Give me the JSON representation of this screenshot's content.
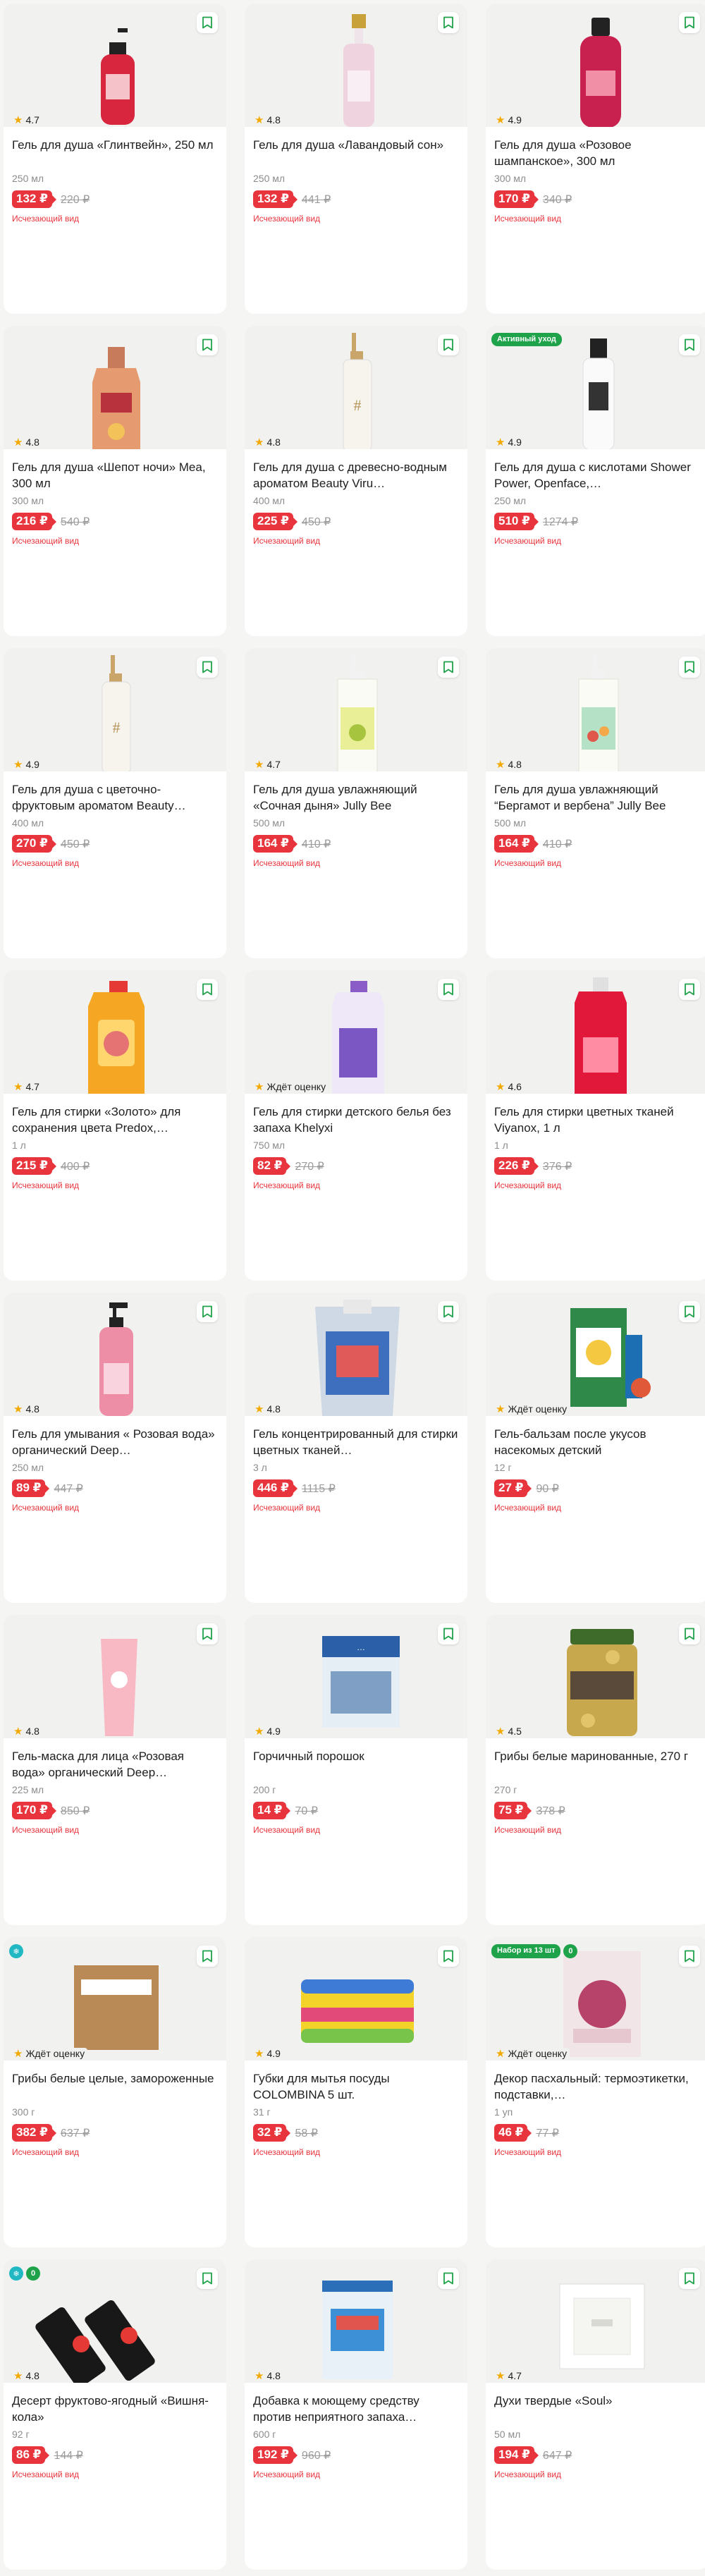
{
  "colors": {
    "sale": "#e8343c",
    "brand": "#1fa34a",
    "star": "#f2a900"
  },
  "products": [
    {
      "title": "Гель для душа «Глинтвейн», 250 мл",
      "rating": "4.7",
      "weight": "250 мл",
      "price": "132 ₽",
      "old_price": "220 ₽",
      "note": "Исчезающий вид",
      "art": "bottle-red"
    },
    {
      "title": "Гель для душа «Лавандовый сон»",
      "rating": "4.8",
      "weight": "250 мл",
      "price": "132 ₽",
      "old_price": "441 ₽",
      "note": "Исчезающий вид",
      "art": "bottle-pink-tall"
    },
    {
      "title": "Гель для душа «Розовое шампанское», 300 мл",
      "rating": "4.9",
      "weight": "300 мл",
      "price": "170 ₽",
      "old_price": "340 ₽",
      "note": "Исчезающий вид",
      "art": "bottle-magenta"
    },
    {
      "title": "Гель для душа «Шепот ночи» Mea, 300 мл",
      "rating": "4.8",
      "weight": "300 мл",
      "price": "216 ₽",
      "old_price": "540 ₽",
      "note": "Исчезающий вид",
      "art": "bottle-amber"
    },
    {
      "title": "Гель для душа с древесно-водным ароматом Beauty Viru…",
      "rating": "4.8",
      "weight": "400 мл",
      "price": "225 ₽",
      "old_price": "450 ₽",
      "note": "Исчезающий вид",
      "art": "bottle-white-pump"
    },
    {
      "title": "Гель для душа с кислотами Shower Power, Openface,…",
      "rating": "4.9",
      "weight": "250 мл",
      "price": "510 ₽",
      "old_price": "1274 ₽",
      "note": "Исчезающий вид",
      "art": "bottle-white-black",
      "badges": [
        "Активный уход"
      ]
    },
    {
      "title": "Гель для душа с цветочно-фруктовым ароматом Beauty…",
      "rating": "4.9",
      "weight": "400 мл",
      "price": "270 ₽",
      "old_price": "450 ₽",
      "note": "Исчезающий вид",
      "art": "bottle-white-pump"
    },
    {
      "title": "Гель для душа увлажняющий «Сочная дыня» Jully Bee",
      "rating": "4.7",
      "weight": "500 мл",
      "price": "164 ₽",
      "old_price": "410 ₽",
      "note": "Исчезающий вид",
      "art": "bottle-yellow-label"
    },
    {
      "title": "Гель для душа увлажняющий “Бергамот и вербена” Jully Bee",
      "rating": "4.8",
      "weight": "500 мл",
      "price": "164 ₽",
      "old_price": "410 ₽",
      "note": "Исчезающий вид",
      "art": "bottle-green-label"
    },
    {
      "title": "Гель для стирки «Золото» для сохранения цвета Predox,…",
      "rating": "4.7",
      "weight": "1 л",
      "price": "215 ₽",
      "old_price": "400 ₽",
      "note": "Исчезающий вид",
      "art": "detergent-yellow"
    },
    {
      "title": "Гель для стирки детского белья без запаха Khelyxi",
      "rating": "Ждёт оценку",
      "weight": "750 мл",
      "price": "82 ₽",
      "old_price": "270 ₽",
      "note": "Исчезающий вид",
      "art": "detergent-purple"
    },
    {
      "title": "Гель для стирки цветных тканей Viyanox, 1 л",
      "rating": "4.6",
      "weight": "1 л",
      "price": "226 ₽",
      "old_price": "376 ₽",
      "note": "Исчезающий вид",
      "art": "detergent-red"
    },
    {
      "title": "Гель для умывания « Розовая вода» органический Deep…",
      "rating": "4.8",
      "weight": "250 мл",
      "price": "89 ₽",
      "old_price": "447 ₽",
      "note": "Исчезающий вид",
      "art": "bottle-pink-pump"
    },
    {
      "title": "Гель концентрированный для стирки цветных тканей…",
      "rating": "4.8",
      "weight": "3 л",
      "price": "446 ₽",
      "old_price": "1115 ₽",
      "note": "Исчезающий вид",
      "art": "pouch-blue"
    },
    {
      "title": "Гель-бальзам после укусов насекомых детский",
      "rating": "Ждёт оценку",
      "weight": "12 г",
      "price": "27 ₽",
      "old_price": "90 ₽",
      "note": "Исчезающий вид",
      "art": "box-kids"
    },
    {
      "title": "Гель-маска для лица «Розовая вода» органический Deep…",
      "rating": "4.8",
      "weight": "225 мл",
      "price": "170 ₽",
      "old_price": "850 ₽",
      "note": "Исчезающий вид",
      "art": "tube-pink"
    },
    {
      "title": "Горчичный порошок",
      "rating": "4.9",
      "weight": "200 г",
      "price": "14 ₽",
      "old_price": "70 ₽",
      "note": "Исчезающий вид",
      "art": "box-mustard"
    },
    {
      "title": "Грибы белые маринованные, 270 г",
      "rating": "4.5",
      "weight": "270 г",
      "price": "75 ₽",
      "old_price": "378 ₽",
      "note": "Исчезающий вид",
      "art": "jar-mushrooms"
    },
    {
      "title": "Грибы белые целые, замороженные",
      "rating": "Ждёт оценку",
      "weight": "300 г",
      "price": "382 ₽",
      "old_price": "637 ₽",
      "note": "Исчезающий вид",
      "art": "box-kraft",
      "round_badges": [
        "❄"
      ]
    },
    {
      "title": "Губки для мытья посуды COLOMBINA 5 шт.",
      "rating": "4.9",
      "weight": "31 г",
      "price": "32 ₽",
      "old_price": "58 ₽",
      "note": "Исчезающий вид",
      "art": "sponges"
    },
    {
      "title": "Декор пасхальный: термоэтикетки, подставки,…",
      "rating": "Ждёт оценку",
      "weight": "1 уп",
      "price": "46 ₽",
      "old_price": "77 ₽",
      "note": "Исчезающий вид",
      "art": "pack-easter",
      "badges": [
        "Набор из 13 шт"
      ],
      "round_badges": [
        "0"
      ]
    },
    {
      "title": "Десерт фруктово-ягодный «Вишня-кола»",
      "rating": "4.8",
      "weight": "92 г",
      "price": "86 ₽",
      "old_price": "144 ₽",
      "note": "Исчезающий вид",
      "art": "bars-cola",
      "round_badges": [
        "❄",
        "0"
      ]
    },
    {
      "title": "Добавка к моющему средству против неприятного запаха…",
      "rating": "4.8",
      "weight": "600 г",
      "price": "192 ₽",
      "old_price": "960 ₽",
      "note": "Исчезающий вид",
      "art": "tub-blue"
    },
    {
      "title": "Духи твердые «Soul»",
      "rating": "4.7",
      "weight": "50 мл",
      "price": "194 ₽",
      "old_price": "647 ₽",
      "note": "Исчезающий вид",
      "art": "box-white"
    }
  ]
}
